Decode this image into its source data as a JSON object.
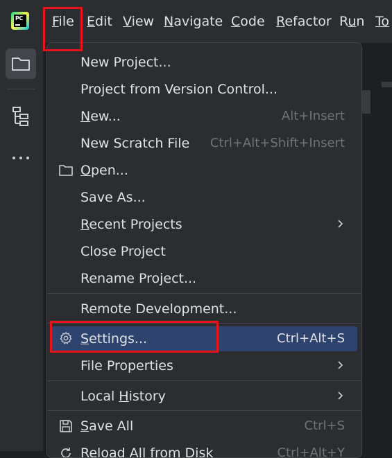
{
  "app": {
    "logo_text": "PC"
  },
  "menubar": {
    "items": [
      {
        "pre": "",
        "u": "F",
        "post": "ile"
      },
      {
        "pre": "",
        "u": "E",
        "post": "dit"
      },
      {
        "pre": "",
        "u": "V",
        "post": "iew"
      },
      {
        "pre": "",
        "u": "N",
        "post": "avigate"
      },
      {
        "pre": "",
        "u": "C",
        "post": "ode"
      },
      {
        "pre": "",
        "u": "R",
        "post": "efactor"
      },
      {
        "pre": "R",
        "u": "u",
        "post": "n"
      },
      {
        "pre": "",
        "u": "To",
        "post": ""
      }
    ]
  },
  "toolstrip": {
    "icons": [
      "folder-icon",
      "structure-icon",
      "more-icon"
    ]
  },
  "file_menu": {
    "items": [
      {
        "pre": "New Project...",
        "u": "",
        "post": "",
        "shortcut": ""
      },
      {
        "pre": "Project from Version Control...",
        "u": "",
        "post": "",
        "shortcut": ""
      },
      {
        "pre": "",
        "u": "N",
        "post": "ew...",
        "shortcut": "Alt+Insert"
      },
      {
        "pre": "New Scratch File",
        "u": "",
        "post": "",
        "shortcut": "Ctrl+Alt+Shift+Insert"
      },
      {
        "pre": "",
        "u": "O",
        "post": "pen...",
        "shortcut": "",
        "icon": "folder-icon"
      },
      {
        "pre": "Save As...",
        "u": "",
        "post": "",
        "shortcut": ""
      },
      {
        "pre": "",
        "u": "R",
        "post": "ecent Projects",
        "shortcut": "",
        "submenu": true
      },
      {
        "pre": "Close Project",
        "u": "",
        "post": "",
        "shortcut": ""
      },
      {
        "pre": "Rename Project...",
        "u": "",
        "post": "",
        "shortcut": ""
      },
      {
        "pre": "Remote Development...",
        "u": "",
        "post": "",
        "shortcut": ""
      },
      {
        "pre": "",
        "u": "",
        "post": "",
        "shortcut": "Ctrl+Alt+S",
        "icon": "gear-icon",
        "selected": true,
        "label": "Settings..."
      },
      {
        "pre": "File Properties",
        "u": "",
        "post": "",
        "shortcut": "",
        "submenu": true
      },
      {
        "pre": "Local ",
        "u": "H",
        "post": "istory",
        "shortcut": "",
        "submenu": true
      },
      {
        "pre": "",
        "u": "S",
        "post": "ave All",
        "shortcut": "Ctrl+S",
        "icon": "save-icon"
      },
      {
        "pre": "Reload All from Disk",
        "u": "",
        "post": "",
        "shortcut": "Ctrl+Alt+Y",
        "icon": "reload-icon"
      }
    ]
  },
  "colors": {
    "highlight_border": "#e8141c",
    "selection": "#2e436e",
    "menu_bg": "#2b2d30"
  }
}
